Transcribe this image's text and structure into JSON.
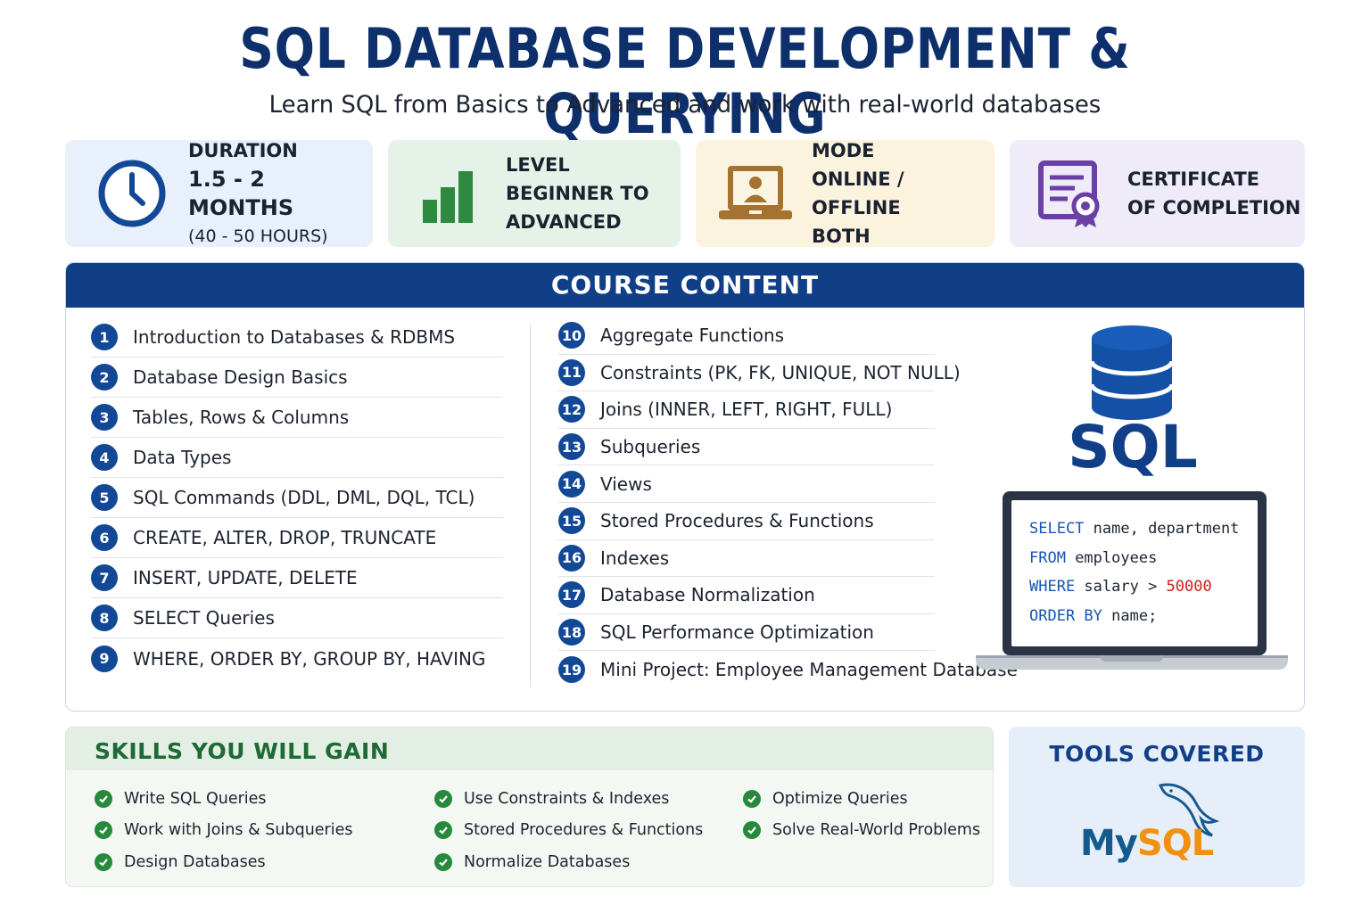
{
  "header": {
    "title": "SQL DATABASE DEVELOPMENT & QUERYING",
    "subtitle": "Learn SQL from Basics to Advanced and work with real-world databases"
  },
  "info_cards": {
    "duration": {
      "label": "DURATION",
      "value": "1.5 - 2 MONTHS",
      "detail": "(40 - 50 HOURS)",
      "icon": "clock-icon",
      "color": "#e7f0fb"
    },
    "level": {
      "label": "LEVEL",
      "line1": "BEGINNER TO",
      "line2": "ADVANCED",
      "icon": "bar-chart-icon",
      "color": "#e5f2e8"
    },
    "mode": {
      "label": "MODE",
      "line1": "ONLINE / OFFLINE",
      "line2": "BOTH",
      "icon": "laptop-user-icon",
      "color": "#fcf3df"
    },
    "certificate": {
      "line1": "CERTIFICATE",
      "line2": "OF COMPLETION",
      "icon": "certificate-icon",
      "color": "#efebf8"
    }
  },
  "course_content": {
    "heading": "COURSE CONTENT",
    "left": [
      {
        "num": "1",
        "label": "Introduction to Databases & RDBMS"
      },
      {
        "num": "2",
        "label": "Database Design Basics"
      },
      {
        "num": "3",
        "label": "Tables, Rows & Columns"
      },
      {
        "num": "4",
        "label": "Data Types"
      },
      {
        "num": "5",
        "label": "SQL Commands (DDL, DML, DQL, TCL)"
      },
      {
        "num": "6",
        "label": "CREATE, ALTER, DROP, TRUNCATE"
      },
      {
        "num": "7",
        "label": "INSERT, UPDATE, DELETE"
      },
      {
        "num": "8",
        "label": "SELECT Queries"
      },
      {
        "num": "9",
        "label": "WHERE, ORDER BY, GROUP BY, HAVING"
      }
    ],
    "right": [
      {
        "num": "10",
        "label": "Aggregate Functions"
      },
      {
        "num": "11",
        "label": "Constraints (PK, FK, UNIQUE, NOT NULL)"
      },
      {
        "num": "12",
        "label": "Joins (INNER, LEFT, RIGHT, FULL)"
      },
      {
        "num": "13",
        "label": "Subqueries"
      },
      {
        "num": "14",
        "label": "Views"
      },
      {
        "num": "15",
        "label": "Stored Procedures & Functions"
      },
      {
        "num": "16",
        "label": "Indexes"
      },
      {
        "num": "17",
        "label": "Database Normalization"
      },
      {
        "num": "18",
        "label": "SQL Performance Optimization"
      },
      {
        "num": "19",
        "label": "Mini Project: Employee Management Database"
      }
    ],
    "illustration": {
      "word": "SQL",
      "code": {
        "l1_kw": "SELECT",
        "l1_rest": " name, department",
        "l2_kw": "FROM",
        "l2_rest": " employees",
        "l3_kw": "WHERE",
        "l3_rest": " salary > ",
        "l3_num": "50000",
        "l4_kw": "ORDER BY",
        "l4_rest": " name;"
      }
    }
  },
  "skills": {
    "heading": "SKILLS YOU WILL GAIN",
    "col1": [
      "Write SQL Queries",
      "Work with Joins & Subqueries",
      "Design Databases"
    ],
    "col2": [
      "Use Constraints & Indexes",
      "Stored Procedures & Functions",
      "Normalize Databases"
    ],
    "col3": [
      "Optimize Queries",
      "Solve Real-World Problems"
    ]
  },
  "tools": {
    "heading": "TOOLS COVERED",
    "logo_my": "My",
    "logo_sql": "SQL"
  },
  "colors": {
    "primary": "#103f88",
    "green": "#27893b",
    "code_keyword": "#1456b3",
    "code_number": "#d11a1a"
  }
}
